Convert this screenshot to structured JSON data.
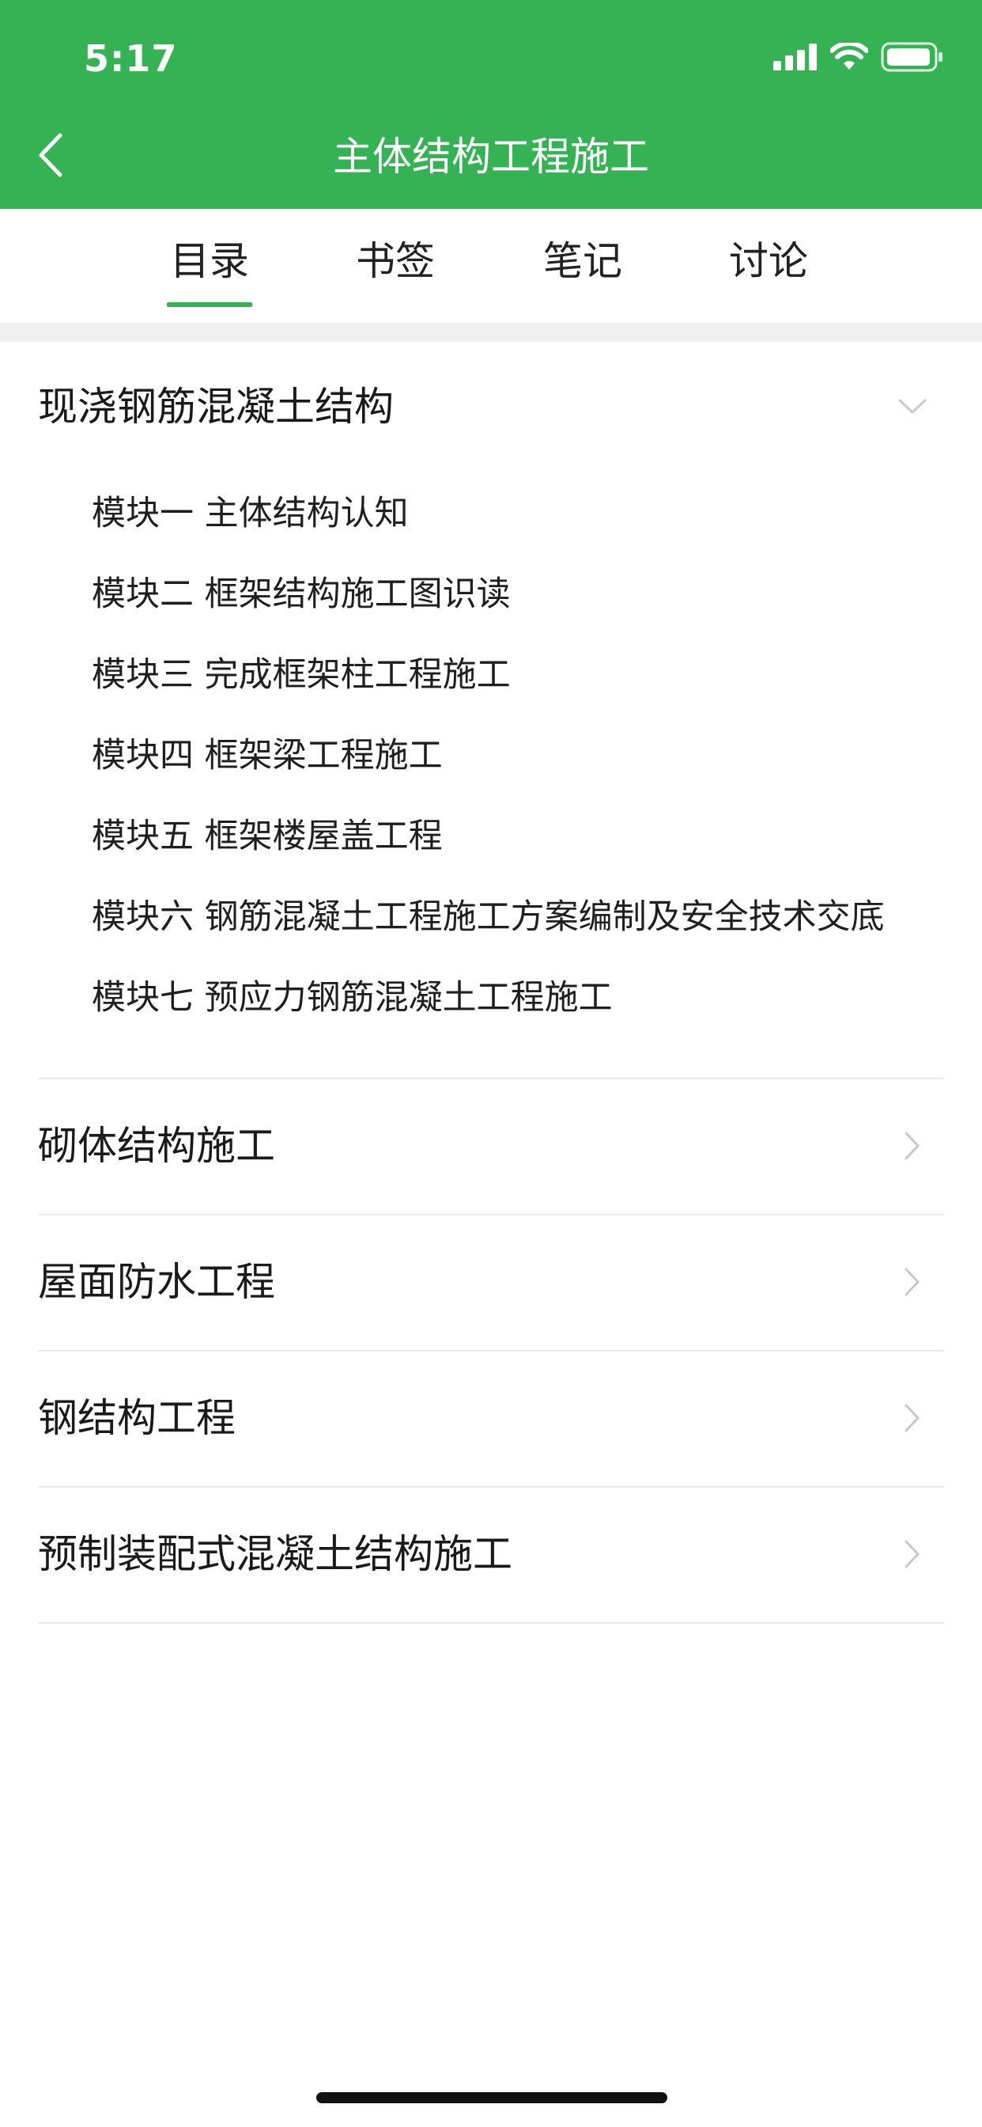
{
  "status_bar": {
    "time": "5:17",
    "icons": [
      "cellular-signal-icon",
      "wifi-icon",
      "battery-icon"
    ]
  },
  "nav": {
    "title": "主体结构工程施工",
    "back_icon": "chevron-left-icon"
  },
  "tabs": [
    {
      "label": "目录",
      "active": true
    },
    {
      "label": "书签",
      "active": false
    },
    {
      "label": "笔记",
      "active": false
    },
    {
      "label": "讨论",
      "active": false
    }
  ],
  "catalog": {
    "expanded_section": {
      "title": "现浇钢筋混凝土结构",
      "icon": "chevron-down-icon",
      "items": [
        "模块一 主体结构认知",
        "模块二 框架结构施工图识读",
        "模块三 完成框架柱工程施工",
        "模块四 框架梁工程施工",
        "模块五 框架楼屋盖工程",
        "模块六 钢筋混凝土工程施工方案编制及安全技术交底",
        "模块七 预应力钢筋混凝土工程施工"
      ]
    },
    "collapsed_sections": [
      {
        "title": "砌体结构施工",
        "icon": "chevron-right-icon"
      },
      {
        "title": "屋面防水工程",
        "icon": "chevron-right-icon"
      },
      {
        "title": "钢结构工程",
        "icon": "chevron-right-icon"
      },
      {
        "title": "预制装配式混凝土结构施工",
        "icon": "chevron-right-icon"
      }
    ]
  },
  "colors": {
    "brand_green": "#35b254",
    "divider": "#e9e9e9",
    "chevron": "#c8c8c8",
    "text": "#1a1a1a"
  }
}
